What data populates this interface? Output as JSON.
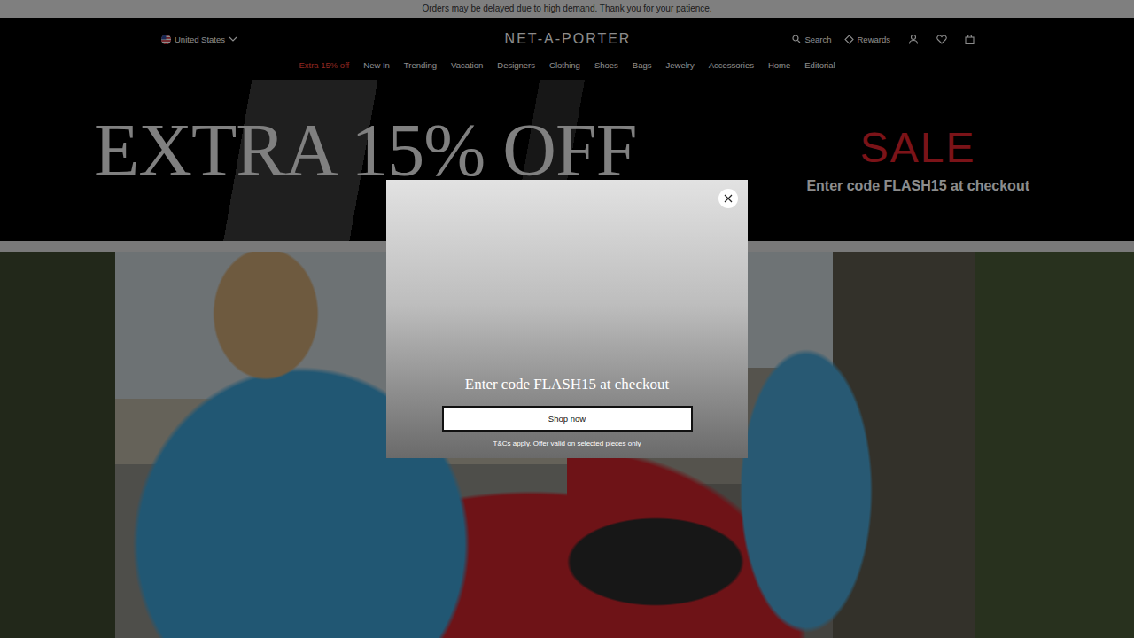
{
  "announcement": "Orders may be delayed due to high demand. Thank you for your patience.",
  "header": {
    "country": "United States",
    "logo": "NET-A-PORTER",
    "actions": [
      {
        "label": "Search"
      },
      {
        "label": "Rewards"
      }
    ]
  },
  "nav": [
    {
      "label": "Extra 15% off",
      "highlighted": true
    },
    {
      "label": "New In",
      "highlighted": false
    },
    {
      "label": "Trending",
      "highlighted": false
    },
    {
      "label": "Vacation",
      "highlighted": false
    },
    {
      "label": "Designers",
      "highlighted": false
    },
    {
      "label": "Clothing",
      "highlighted": false
    },
    {
      "label": "Shoes",
      "highlighted": false
    },
    {
      "label": "Bags",
      "highlighted": false
    },
    {
      "label": "Jewelry",
      "highlighted": false
    },
    {
      "label": "Accessories",
      "highlighted": false
    },
    {
      "label": "Home",
      "highlighted": false
    },
    {
      "label": "Editorial",
      "highlighted": false
    }
  ],
  "banner": {
    "headline": "EXTRA 15% OFF",
    "sale": "SALE",
    "code_text": "Enter code FLASH15 at checkout"
  },
  "modal": {
    "message": "Enter code FLASH15 at checkout",
    "button": "Shop now",
    "terms": "T&Cs apply. Offer valid on selected pieces only"
  }
}
